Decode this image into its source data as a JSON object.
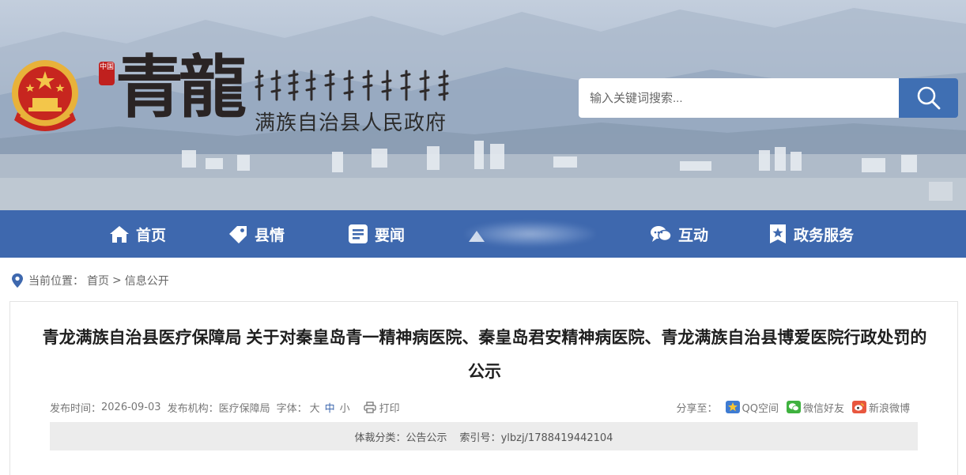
{
  "header": {
    "seal_text": "中国",
    "calligraphy": "青龍",
    "county_name": "满族自治县人民政府",
    "search": {
      "placeholder": "输入关键词搜索..."
    }
  },
  "nav": {
    "items": [
      {
        "label": "首页",
        "icon": "home-icon"
      },
      {
        "label": "县情",
        "icon": "tag-icon"
      },
      {
        "label": "要闻",
        "icon": "news-icon"
      },
      {
        "label": "",
        "icon": "blurred-icon"
      },
      {
        "label": "互动",
        "icon": "chat-icon"
      },
      {
        "label": "政务服务",
        "icon": "star-badge-icon"
      }
    ],
    "bg_color": "#3e68ae"
  },
  "breadcrumb": {
    "prefix": "当前位置：",
    "home": "首页",
    "sep": ">",
    "current": "信息公开"
  },
  "article": {
    "title": "青龙满族自治县医疗保障局 关于对秦皇岛青一精神病医院、秦皇岛君安精神病医院、青龙满族自治县博爱医院行政处罚的公示",
    "meta": {
      "date_label": "发布时间：",
      "date": "2026-09-03",
      "org_label": "发布机构：",
      "org": "医疗保障局",
      "font_label": "字体：",
      "font_large": "大",
      "font_medium": "中",
      "font_small": "小",
      "print": "打印"
    },
    "share": {
      "label": "分享至：",
      "qq": "QQ空间",
      "wechat": "微信好友",
      "weibo": "新浪微博"
    },
    "info": {
      "category_label": "体裁分类：",
      "category": "公告公示",
      "index_label": "索引号：",
      "index": "ylbzj/1788419442104"
    }
  },
  "colors": {
    "accent": "#3e68ae",
    "search_button": "#3f6fb3"
  }
}
